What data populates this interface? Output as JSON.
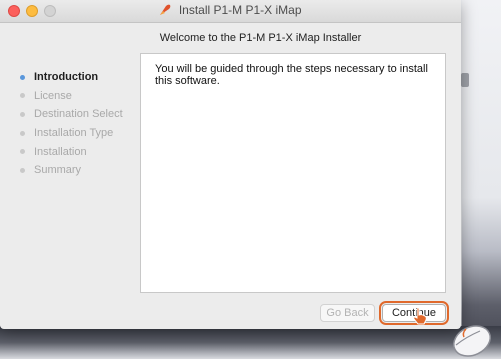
{
  "window": {
    "title": "Install P1-M P1-X iMap",
    "heading": "Welcome to the P1-M P1-X iMap Installer"
  },
  "steps": [
    {
      "label": "Introduction",
      "active": true
    },
    {
      "label": "License",
      "active": false
    },
    {
      "label": "Destination Select",
      "active": false
    },
    {
      "label": "Installation Type",
      "active": false
    },
    {
      "label": "Installation",
      "active": false
    },
    {
      "label": "Summary",
      "active": false
    }
  ],
  "content": {
    "body": "You will be guided through the steps necessary to install this software."
  },
  "buttons": {
    "back_label": "Go Back",
    "continue_label": "Continue"
  },
  "icons": {
    "title_icon": "package-installer-icon",
    "cursor": "pointer-cursor-icon",
    "mouse": "mouse-icon"
  },
  "colors": {
    "active_step": "#5a97db",
    "highlight": "#e0692c"
  }
}
